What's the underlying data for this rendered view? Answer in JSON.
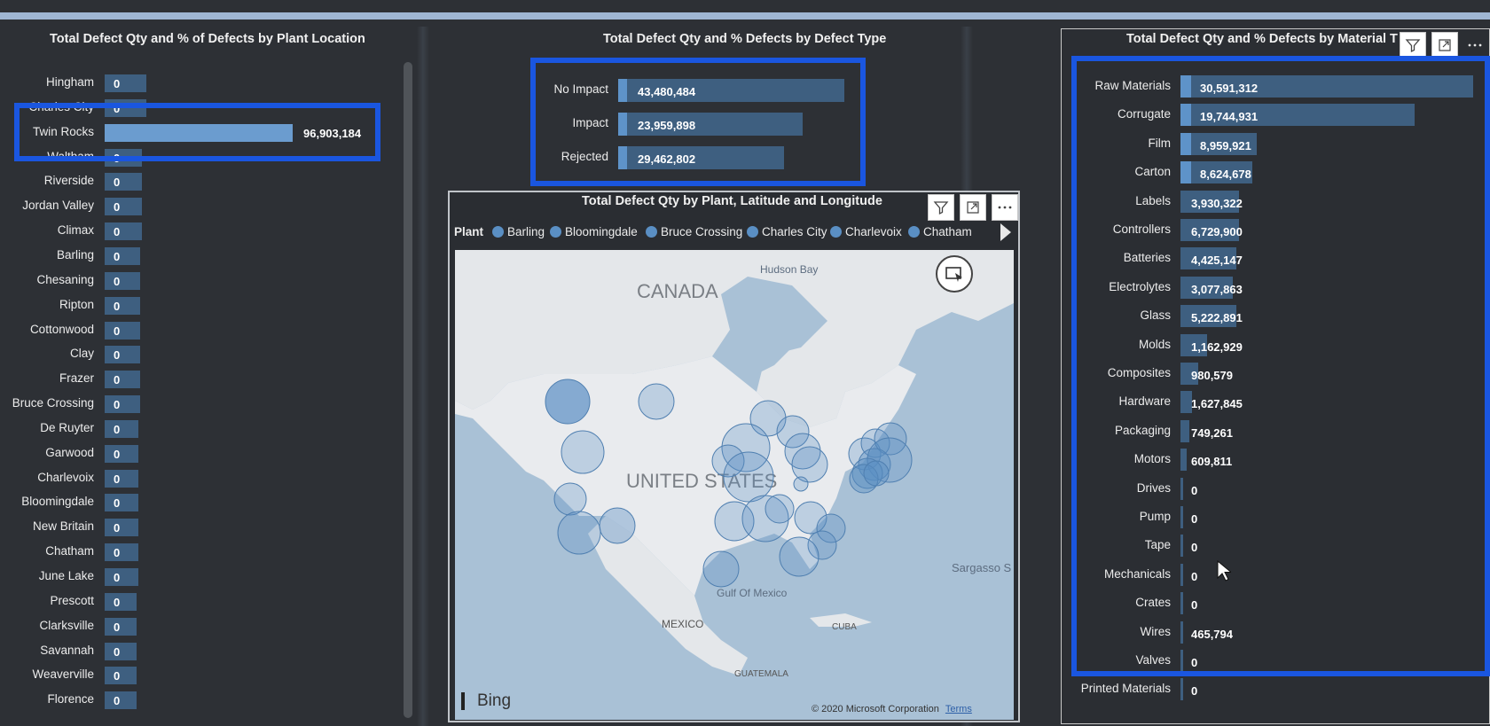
{
  "left_panel": {
    "title": "Total Defect Qty and % of Defects by Plant Location",
    "rows": [
      {
        "label": "Hingham",
        "value": "0",
        "bar": 0.22
      },
      {
        "label": "Charles City",
        "value": "0",
        "bar": 0.22
      },
      {
        "label": "Twin Rocks",
        "value": "96,903,184",
        "bar": 1.0,
        "highlight": true
      },
      {
        "label": "Waltham",
        "value": "0",
        "bar": 0.2
      },
      {
        "label": "Riverside",
        "value": "0",
        "bar": 0.2
      },
      {
        "label": "Jordan Valley",
        "value": "0",
        "bar": 0.2
      },
      {
        "label": "Climax",
        "value": "0",
        "bar": 0.2
      },
      {
        "label": "Barling",
        "value": "0",
        "bar": 0.19
      },
      {
        "label": "Chesaning",
        "value": "0",
        "bar": 0.19
      },
      {
        "label": "Ripton",
        "value": "0",
        "bar": 0.19
      },
      {
        "label": "Cottonwood",
        "value": "0",
        "bar": 0.19
      },
      {
        "label": "Clay",
        "value": "0",
        "bar": 0.19
      },
      {
        "label": "Frazer",
        "value": "0",
        "bar": 0.19
      },
      {
        "label": "Bruce Crossing",
        "value": "0",
        "bar": 0.19
      },
      {
        "label": "De Ruyter",
        "value": "0",
        "bar": 0.18
      },
      {
        "label": "Garwood",
        "value": "0",
        "bar": 0.18
      },
      {
        "label": "Charlevoix",
        "value": "0",
        "bar": 0.18
      },
      {
        "label": "Bloomingdale",
        "value": "0",
        "bar": 0.18
      },
      {
        "label": "New Britain",
        "value": "0",
        "bar": 0.18
      },
      {
        "label": "Chatham",
        "value": "0",
        "bar": 0.18
      },
      {
        "label": "June Lake",
        "value": "0",
        "bar": 0.18
      },
      {
        "label": "Prescott",
        "value": "0",
        "bar": 0.17
      },
      {
        "label": "Clarksville",
        "value": "0",
        "bar": 0.17
      },
      {
        "label": "Savannah",
        "value": "0",
        "bar": 0.17
      },
      {
        "label": "Weaverville",
        "value": "0",
        "bar": 0.17
      },
      {
        "label": "Florence",
        "value": "0",
        "bar": 0.17
      }
    ]
  },
  "defect_type_panel": {
    "title": "Total Defect Qty and % Defects by Defect Type",
    "rows": [
      {
        "label": "No Impact",
        "value": "43,480,484",
        "bar": 1.0
      },
      {
        "label": "Impact",
        "value": "23,959,898",
        "bar": 0.815
      },
      {
        "label": "Rejected",
        "value": "29,462,802",
        "bar": 0.735
      }
    ]
  },
  "map_panel": {
    "title": "Total Defect Qty by Plant, Latitude and Longitude",
    "legend_title": "Plant",
    "legend": [
      "Barling",
      "Bloomingdale",
      "Bruce Crossing",
      "Charles City",
      "Charlevoix",
      "Chatham"
    ],
    "labels": {
      "canada": "CANADA",
      "united_states": "UNITED STATES",
      "hudson_bay": "Hudson Bay",
      "gulf": "Gulf Of Mexico",
      "mexico": "MEXICO",
      "cuba": "CUBA",
      "sargasso": "Sargasso S",
      "guatemala": "GUATEMALA",
      "bing": "Bing",
      "copyright": "© 2020 Microsoft Corporation",
      "terms": "Terms"
    }
  },
  "material_panel": {
    "title": "Total Defect Qty and % Defects by Material T",
    "rows": [
      {
        "label": "Raw Materials",
        "value": "30,591,312",
        "bar": 1.0
      },
      {
        "label": "Corrugate",
        "value": "19,744,931",
        "bar": 0.8
      },
      {
        "label": "Film",
        "value": "8,959,921",
        "bar": 0.26
      },
      {
        "label": "Carton",
        "value": "8,624,678",
        "bar": 0.245
      },
      {
        "label": "Labels",
        "value": "3,930,322",
        "bar": 0.2
      },
      {
        "label": "Controllers",
        "value": "6,729,900",
        "bar": 0.2
      },
      {
        "label": "Batteries",
        "value": "4,425,147",
        "bar": 0.19
      },
      {
        "label": "Electrolytes",
        "value": "3,077,863",
        "bar": 0.18
      },
      {
        "label": "Glass",
        "value": "5,222,891",
        "bar": 0.19
      },
      {
        "label": "Molds",
        "value": "1,162,929",
        "bar": 0.09
      },
      {
        "label": "Composites",
        "value": "980,579",
        "bar": 0.06
      },
      {
        "label": "Hardware",
        "value": "1,627,845",
        "bar": 0.04
      },
      {
        "label": "Packaging",
        "value": "749,261",
        "bar": 0.03
      },
      {
        "label": "Motors",
        "value": "609,811",
        "bar": 0.02
      },
      {
        "label": "Drives",
        "value": "0",
        "bar": 0.01
      },
      {
        "label": "Pump",
        "value": "0",
        "bar": 0.005
      },
      {
        "label": "Tape",
        "value": "0",
        "bar": 0.005
      },
      {
        "label": "Mechanicals",
        "value": "0",
        "bar": 0.005
      },
      {
        "label": "Crates",
        "value": "0",
        "bar": 0.005
      },
      {
        "label": "Wires",
        "value": "465,794",
        "bar": 0.005
      },
      {
        "label": "Valves",
        "value": "0",
        "bar": 0.005
      },
      {
        "label": "Printed Materials",
        "value": "0",
        "bar": 0.005
      }
    ]
  },
  "colors": {
    "bar": "#3e5f80",
    "bar_highlight": "#6b9ccf",
    "highlight_box": "#1a56e0",
    "accent": "#5e93c9"
  }
}
